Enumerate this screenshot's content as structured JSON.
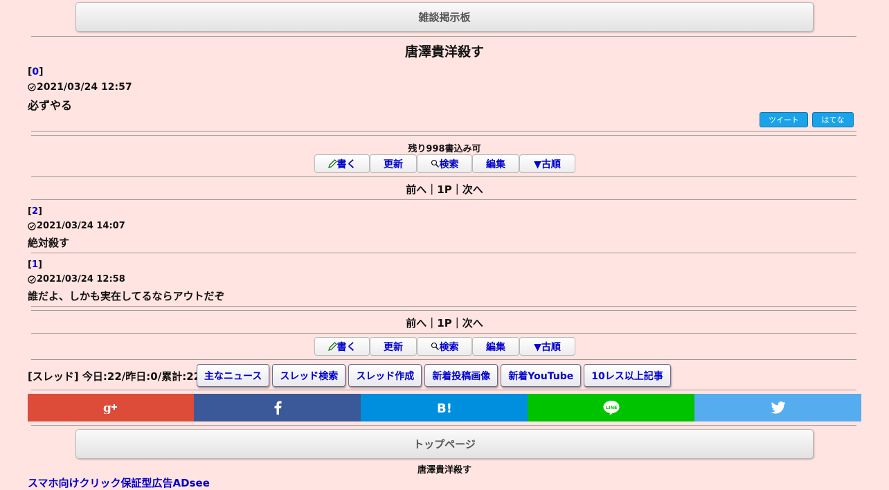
{
  "header": {
    "board_label": "雑談掲示板"
  },
  "thread": {
    "title": "唐澤貴洋殺す"
  },
  "op": {
    "num_open": "[",
    "num": "0",
    "num_close": "]",
    "date": "2021/03/24 12:57",
    "body": "必ずやる"
  },
  "share_small": {
    "tweet": "ツイート",
    "hatena": "はてな"
  },
  "remaining": "残り998書込み可",
  "toolbar": {
    "write": "書く",
    "refresh": "更新",
    "search": "検索",
    "edit": "編集",
    "order": "▼古順"
  },
  "pager": "前へ｜1P｜次へ",
  "posts": [
    {
      "num_open": "[",
      "num": "2",
      "num_close": "]",
      "date": "2021/03/24 14:07",
      "body": "絶対殺す"
    },
    {
      "num_open": "[",
      "num": "1",
      "num_close": "]",
      "date": "2021/03/24 12:58",
      "body": "誰だよ、しかも実在してるならアウトだぞ"
    }
  ],
  "stats": "[スレッド] 今日:22/昨日:0/累計:22",
  "nav_buttons": [
    "主なニュース",
    "スレッド検索",
    "スレッド作成",
    "新着投稿画像",
    "新着YouTube",
    "10レス以上記事"
  ],
  "share_bar": {
    "colors": {
      "gplus": "#dd4b39",
      "facebook": "#3b5998",
      "hatena": "#008fde",
      "line": "#00c300",
      "twitter": "#55acee"
    },
    "icons": [
      "google-plus-icon",
      "facebook-icon",
      "hatena-bookmark-icon",
      "line-icon",
      "twitter-icon"
    ]
  },
  "footer": {
    "top_page": "トップページ",
    "thread_title": "唐澤貴洋殺す",
    "ad_link": "スマホ向けクリック保証型広告ADsee"
  }
}
